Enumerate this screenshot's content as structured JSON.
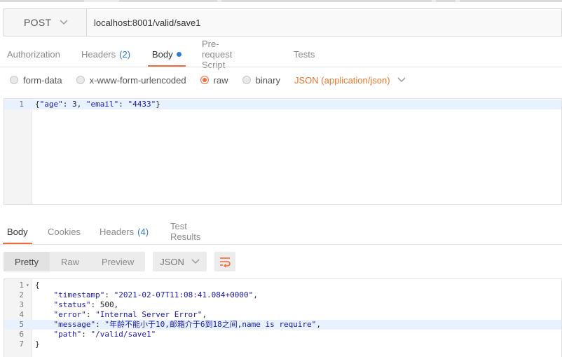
{
  "request": {
    "method": "POST",
    "url": "localhost:8001/valid/save1"
  },
  "request_tabs": [
    {
      "label": "Authorization",
      "count": "",
      "active": false
    },
    {
      "label": "Headers",
      "count": "(2)",
      "active": false
    },
    {
      "label": "Body",
      "count": "",
      "active": true
    },
    {
      "label": "Pre-request Script",
      "count": "",
      "active": false
    },
    {
      "label": "Tests",
      "count": "",
      "active": false
    }
  ],
  "body_types": {
    "options": [
      "form-data",
      "x-www-form-urlencoded",
      "raw",
      "binary"
    ],
    "selected": "raw",
    "content_type": "JSON (application/json)"
  },
  "request_body": {
    "lines": [
      {
        "num": "1",
        "text": "{\"age\": 3, \"email\": \"4433\"}"
      }
    ]
  },
  "response_tabs": [
    {
      "label": "Body",
      "count": "",
      "active": true
    },
    {
      "label": "Cookies",
      "count": "",
      "active": false
    },
    {
      "label": "Headers",
      "count": "(4)",
      "active": false
    },
    {
      "label": "Test Results",
      "count": "",
      "active": false
    }
  ],
  "response_toolbar": {
    "views": [
      "Pretty",
      "Raw",
      "Preview"
    ],
    "active_view": "Pretty",
    "format": "JSON"
  },
  "response_body": {
    "lines": [
      {
        "num": "1",
        "text": "{"
      },
      {
        "num": "2",
        "text": "    \"timestamp\": \"2021-02-07T11:08:41.084+0000\","
      },
      {
        "num": "3",
        "text": "    \"status\": 500,"
      },
      {
        "num": "4",
        "text": "    \"error\": \"Internal Server Error\","
      },
      {
        "num": "5",
        "text": "    \"message\": \"年龄不能小于10,邮箱介于6到18之间,name is require\","
      },
      {
        "num": "6",
        "text": "    \"path\": \"/valid/save1\""
      },
      {
        "num": "7",
        "text": "}"
      }
    ],
    "highlight_line": "5"
  },
  "colors": {
    "accent": "#f26b3a",
    "count_blue": "#2e7bcf",
    "content_type": "#e8752c"
  }
}
